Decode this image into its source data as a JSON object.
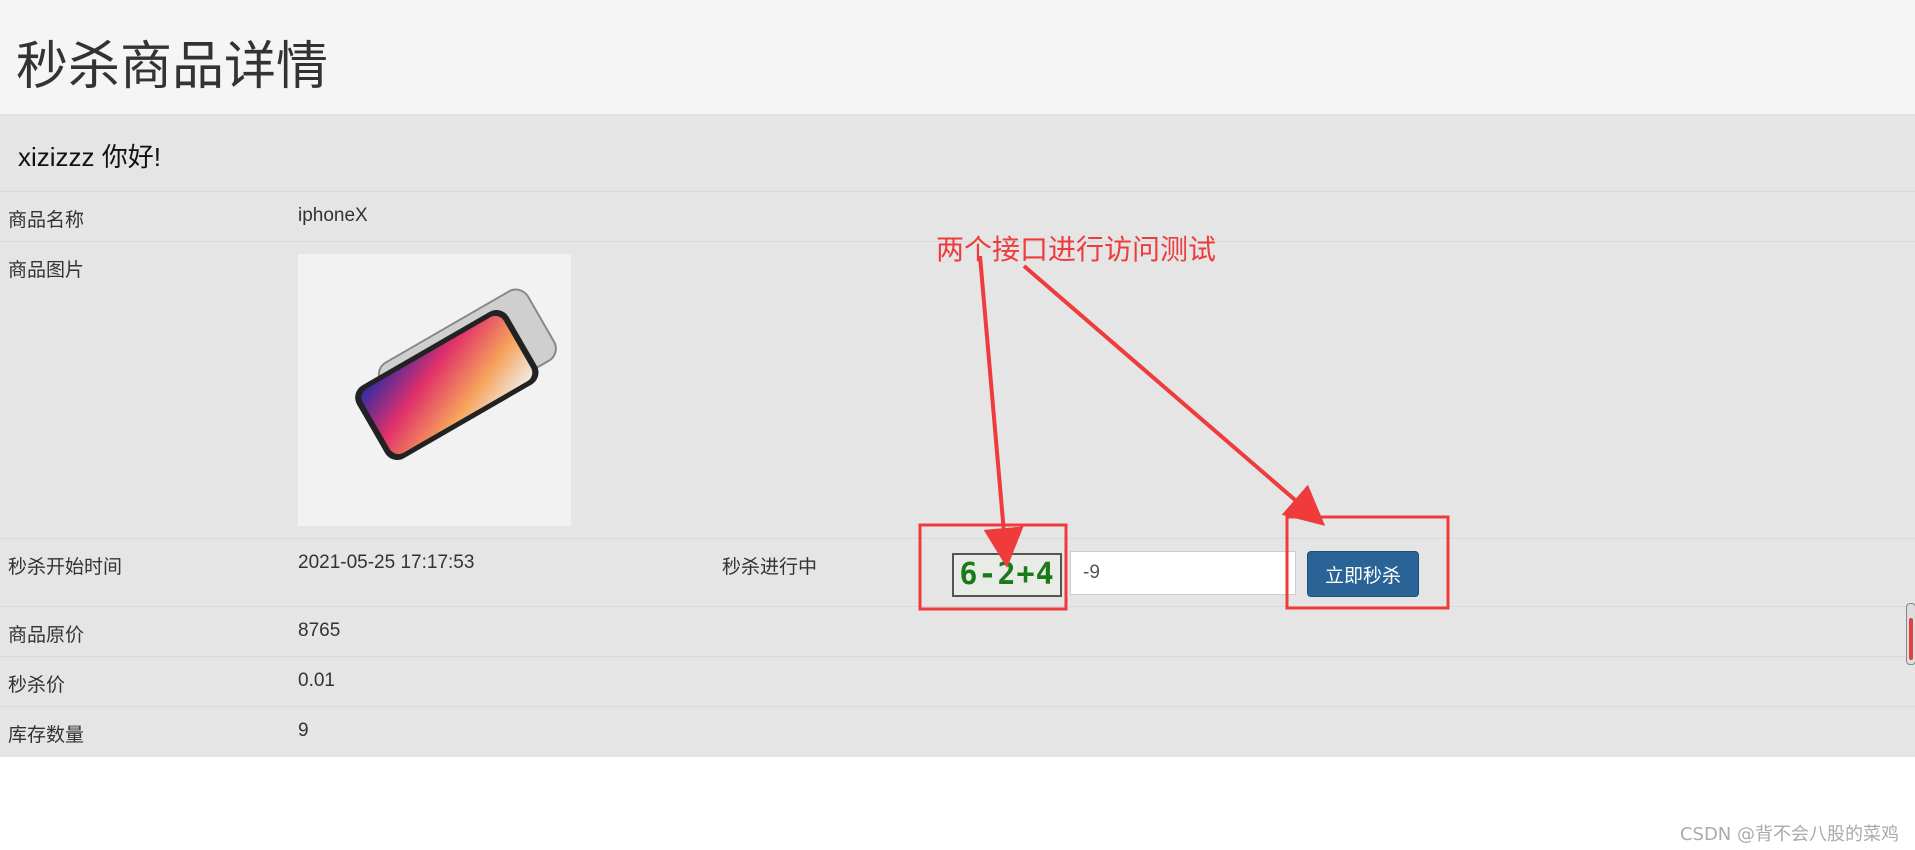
{
  "page": {
    "title": "秒杀商品详情"
  },
  "user": {
    "greeting": "xizizzz 你好!"
  },
  "details": {
    "name_label": "商品名称",
    "name_value": "iphoneX",
    "image_label": "商品图片",
    "start_label": "秒杀开始时间",
    "start_value": "2021-05-25 17:17:53",
    "status": "秒杀进行中",
    "price_label": "商品原价",
    "price_value": "8765",
    "seckill_label": "秒杀价",
    "seckill_value": "0.01",
    "stock_label": "库存数量",
    "stock_value": "9"
  },
  "seckill": {
    "captcha_text": "6-2+4",
    "answer_value": "-9",
    "button_label": "立即秒杀"
  },
  "annotation": {
    "text": "两个接口进行访问测试",
    "color": "#ef3b3b"
  },
  "watermark": "CSDN @背不会八股的菜鸡",
  "colors": {
    "button": "#2a6496",
    "captcha_text": "#1a7a1a"
  }
}
